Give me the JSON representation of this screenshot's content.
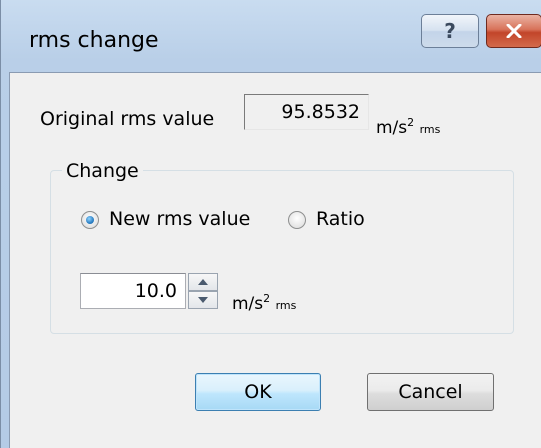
{
  "window": {
    "title": "rms change",
    "help_label": "?",
    "close_icon": "close-icon"
  },
  "original": {
    "label": "Original rms value",
    "value": "95.8532",
    "unit_base": "m/s",
    "unit_exp": "2",
    "unit_suffix": "rms"
  },
  "change": {
    "group_title": "Change",
    "options": [
      {
        "label": "New rms value",
        "checked": true
      },
      {
        "label": "Ratio",
        "checked": false
      }
    ],
    "input_value": "10.0",
    "unit_base": "m/s",
    "unit_exp": "2",
    "unit_suffix": "rms"
  },
  "buttons": {
    "ok": "OK",
    "cancel": "Cancel"
  },
  "colors": {
    "title_bar": "#b9cfe8",
    "close_button": "#c2452a",
    "default_button_border": "#3c7fb1",
    "radio_dot": "#2c7fc4"
  }
}
